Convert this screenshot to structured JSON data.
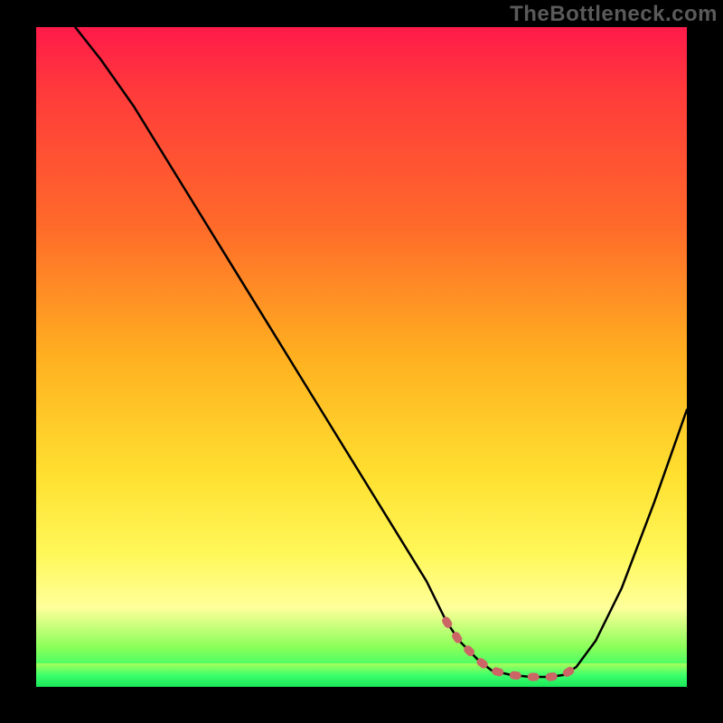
{
  "watermark": "TheBottleneck.com",
  "chart_data": {
    "type": "line",
    "title": "",
    "xlabel": "",
    "ylabel": "",
    "xlim": [
      0,
      100
    ],
    "ylim": [
      0,
      100
    ],
    "series": [
      {
        "name": "bottleneck-curve",
        "color": "#000000",
        "x": [
          6,
          10,
          15,
          20,
          25,
          30,
          35,
          40,
          45,
          50,
          55,
          60,
          63,
          65,
          68,
          70,
          73,
          76,
          79,
          81,
          83,
          86,
          90,
          95,
          100
        ],
        "y": [
          100,
          95,
          88,
          80,
          72,
          64,
          56,
          48,
          40,
          32,
          24,
          16,
          10,
          7,
          4,
          2.5,
          1.8,
          1.5,
          1.5,
          1.8,
          3,
          7,
          15,
          28,
          42
        ]
      },
      {
        "name": "optimal-range-marker",
        "color": "#cc6666",
        "x": [
          63,
          65,
          68,
          70,
          73,
          76,
          79,
          81,
          83
        ],
        "y": [
          10,
          7,
          4,
          2.5,
          1.8,
          1.5,
          1.5,
          1.8,
          3
        ]
      }
    ],
    "annotations": []
  }
}
